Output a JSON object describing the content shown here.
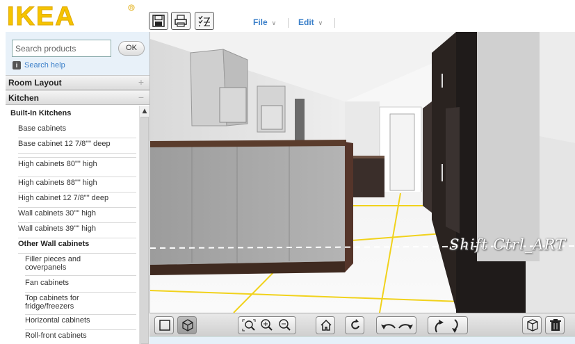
{
  "brand": {
    "logo_text": "IKEA",
    "colors": {
      "blue": "#0058a3",
      "yellow": "#ffda1a",
      "link": "#3a7fc9"
    }
  },
  "header": {
    "icons": [
      "save-icon",
      "print-icon",
      "checklist-icon"
    ],
    "menus": [
      {
        "label": "File"
      },
      {
        "label": "Edit"
      }
    ]
  },
  "search": {
    "placeholder": "Search products",
    "button_label": "OK",
    "help_label": "Search help"
  },
  "sections": [
    {
      "label": "Room Layout",
      "toggle": "+"
    },
    {
      "label": "Kitchen",
      "toggle": "−"
    }
  ],
  "tree": {
    "items": [
      {
        "label": "Built-In Kitchens"
      },
      {
        "label": "Base cabinets"
      },
      {
        "label": "Base cabinet 12 7/8\"\" deep"
      },
      {
        "label": "High cabinets 80\"\" high"
      },
      {
        "label": "High cabinets 88\"\" high"
      },
      {
        "label": "High cabinet 12 7/8\"\" deep"
      },
      {
        "label": "Wall cabinets 30\"\" high"
      },
      {
        "label": "Wall cabinets 39\"\" high"
      },
      {
        "label": "Other Wall cabinets"
      },
      {
        "label": "Filler pieces and coverpanels"
      },
      {
        "label": "Fan cabinets"
      },
      {
        "label": "Top cabinets for fridge/freezers"
      },
      {
        "label": "Horizontal cabinets"
      },
      {
        "label": "Roll-front cabinets"
      }
    ]
  },
  "viewport": {
    "watermark": "Shift Ctrl_ART"
  },
  "toolbar": {
    "tools": [
      "2d-view-icon",
      "3d-view-icon",
      "zoom-fit-icon",
      "zoom-in-icon",
      "zoom-out-icon",
      "home-icon",
      "undo-rotate-icon",
      "rotate-left-icon",
      "rotate-right-icon",
      "tilt-up-icon",
      "tilt-down-icon",
      "3d-box-icon",
      "trash-icon"
    ]
  }
}
